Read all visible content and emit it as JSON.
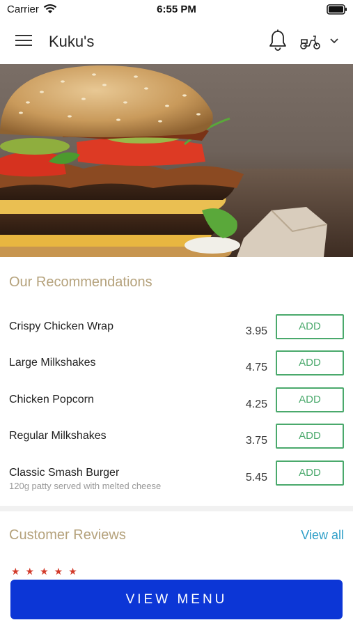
{
  "status_bar": {
    "carrier": "Carrier",
    "time": "6:55 PM"
  },
  "nav": {
    "title": "Kuku's"
  },
  "recommendations": {
    "title": "Our Recommendations",
    "items": [
      {
        "name": "Crispy Chicken Wrap",
        "description": "",
        "price": "3.95",
        "add_label": "ADD"
      },
      {
        "name": "Large Milkshakes",
        "description": "",
        "price": "4.75",
        "add_label": "ADD"
      },
      {
        "name": "Chicken Popcorn",
        "description": "",
        "price": "4.25",
        "add_label": "ADD"
      },
      {
        "name": "Regular Milkshakes",
        "description": "",
        "price": "3.75",
        "add_label": "ADD"
      },
      {
        "name": "Classic Smash Burger",
        "description": "120g patty served with melted cheese",
        "price": "5.45",
        "add_label": "ADD"
      }
    ]
  },
  "reviews": {
    "title": "Customer Reviews",
    "view_all_label": "View all",
    "stars": "★★★★★"
  },
  "footer": {
    "view_menu_label": "VIEW MENU"
  },
  "colors": {
    "accent_gold": "#b5a27c",
    "add_green": "#4aa96c",
    "link_blue": "#2f9fc8",
    "cta_blue": "#0c36d6"
  },
  "icons": [
    "wifi-icon",
    "battery-icon",
    "hamburger-menu-icon",
    "bell-icon",
    "scooter-icon",
    "chevron-down-icon"
  ]
}
